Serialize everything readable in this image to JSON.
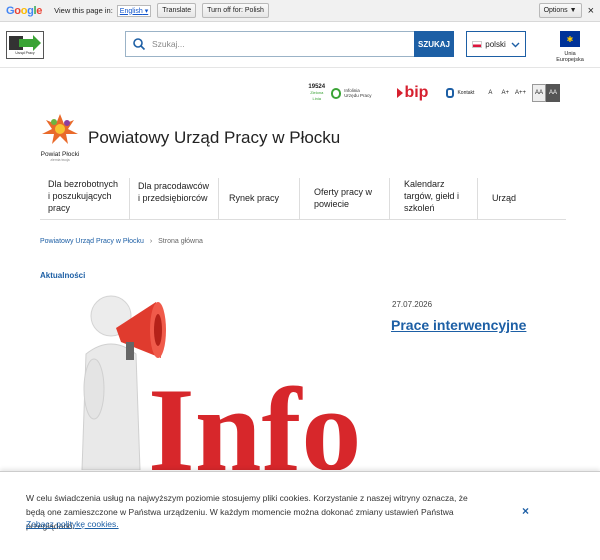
{
  "translate_bar": {
    "logo_letters": [
      "G",
      "o",
      "o",
      "g",
      "l",
      "e"
    ],
    "view_text": "View this page in:",
    "language": "English",
    "translate_label": "Translate",
    "turn_off_label": "Turn off for: Polish",
    "options_label": "Options ▼",
    "close": "×"
  },
  "header": {
    "logo_text": "Urząd Pracy",
    "search_placeholder": "Szukaj...",
    "search_button": "SZUKAJ",
    "language": "polski",
    "eu_label": "Unia Europejska"
  },
  "utility": {
    "hotline_number": "19524",
    "hotline_sub": "Zielona Linia",
    "infolinia": "Infolinia\nUrzędu Pracy",
    "bip": "bip",
    "contact": "Kontakt",
    "font_sizes": [
      "A",
      "A+",
      "A++"
    ],
    "contrast": [
      "AA",
      "AA"
    ]
  },
  "site": {
    "crest_caption": "Powiat Płocki",
    "crest_sub": "ziemia twoja",
    "title": "Powiatowy Urząd Pracy w Płocku"
  },
  "nav": [
    {
      "label": "Dla bezrobotnych i poszukujących pracy"
    },
    {
      "label": "Dla pracodawców i przedsiębiorców"
    },
    {
      "label": "Rynek pracy"
    },
    {
      "label": "Oferty pracy w powiecie"
    },
    {
      "label": "Kalendarz targów, giełd i szkoleń"
    },
    {
      "label": "Urząd"
    }
  ],
  "breadcrumb": {
    "home": "Powiatowy Urząd Pracy w Płocku",
    "separator": "›",
    "current": "Strona główna"
  },
  "section_title": "Aktualności",
  "article": {
    "date": "27.07.2026",
    "title": "Prace interwencyjne",
    "image_text": "Info"
  },
  "cookie": {
    "text": "W celu świadczenia usług na najwyższym poziomie stosujemy pliki cookies. Korzystanie z naszej witryny oznacza, że będą one zamieszczone w Państwa urządzeniu. W każdym momencie można dokonać zmiany ustawień Państwa przeglądarki.",
    "link": "Zobacz politykę cookies.",
    "close": "×"
  },
  "colors": {
    "accent": "#1d5fa5",
    "bip_red": "#d6202f",
    "info_red": "#d7272b"
  }
}
